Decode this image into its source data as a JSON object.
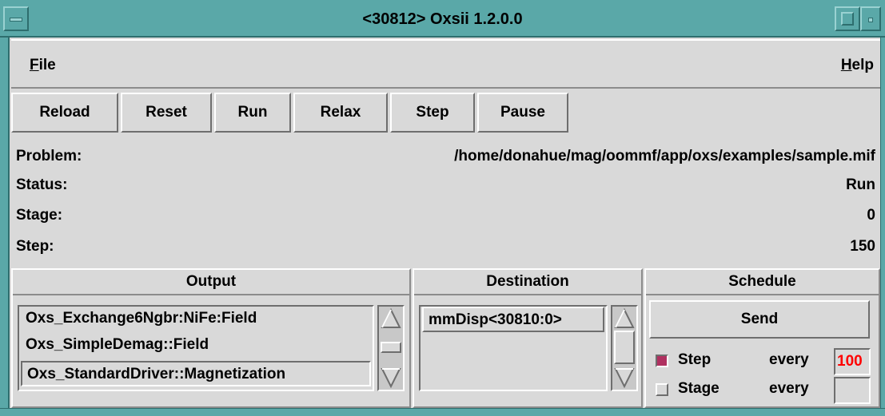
{
  "window": {
    "title": "<30812> Oxsii 1.2.0.0"
  },
  "menu": {
    "file_label": "F",
    "file_rest": "ile",
    "help_label": "H",
    "help_rest": "elp"
  },
  "toolbar": {
    "buttons": [
      "Reload",
      "Reset",
      "Run",
      "Relax",
      "Step",
      "Pause"
    ]
  },
  "info": {
    "problem_label": "Problem:",
    "problem_value": "/home/donahue/mag/oommf/app/oxs/examples/sample.mif",
    "status_label": "Status:",
    "status_value": "Run",
    "stage_label": "Stage:",
    "stage_value": "0",
    "step_label": "Step:",
    "step_value": "150"
  },
  "output": {
    "header": "Output",
    "items": [
      "Oxs_Exchange6Ngbr:NiFe:Field",
      "Oxs_SimpleDemag::Field",
      "Oxs_StandardDriver::Magnetization"
    ]
  },
  "destination": {
    "header": "Destination",
    "items": [
      "mmDisp<30810:0>"
    ]
  },
  "schedule": {
    "header": "Schedule",
    "send_label": "Send",
    "step_label": "Step",
    "step_checked": true,
    "step_every_label": "every",
    "step_every_value": "100",
    "stage_label": "Stage",
    "stage_checked": false,
    "stage_every_label": "every",
    "stage_every_value": ""
  },
  "colors": {
    "frame": "#5aa8a8",
    "background": "#d9d9d9",
    "checkbox_checked": "#b03060",
    "input_text": "#ff0000"
  }
}
